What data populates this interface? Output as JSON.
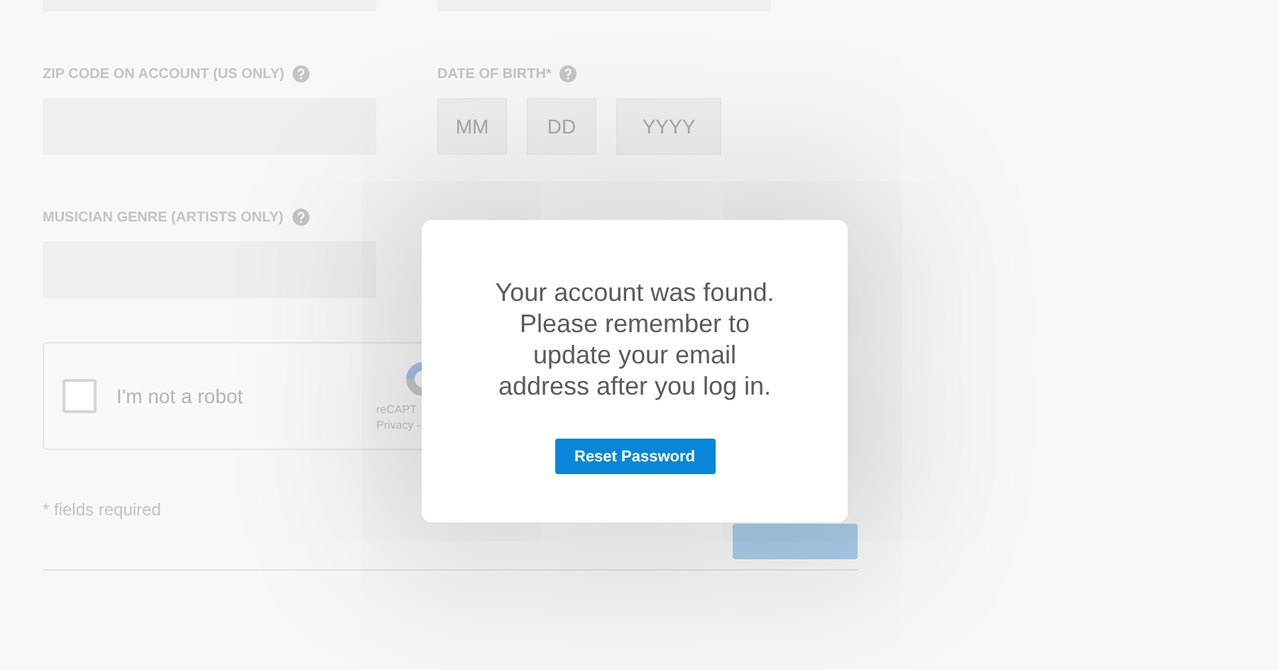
{
  "form": {
    "zip_label": "ZIP CODE ON ACCOUNT (US ONLY)",
    "dob_label": "DATE OF BIRTH*",
    "dob_fields": [
      {
        "placeholder": "MM"
      },
      {
        "placeholder": "DD"
      },
      {
        "placeholder": "YYYY"
      }
    ],
    "genre_label": "MUSICIAN GENRE (ARTISTS ONLY)",
    "captcha": {
      "label": "I'm not a robot",
      "checked": false,
      "brand": "reCAPT",
      "links": "Privacy -"
    },
    "required_note": "* fields required"
  },
  "dialog": {
    "message": "Your account was found. Please remember to update your email address after you log in.",
    "button": "Reset Password"
  }
}
